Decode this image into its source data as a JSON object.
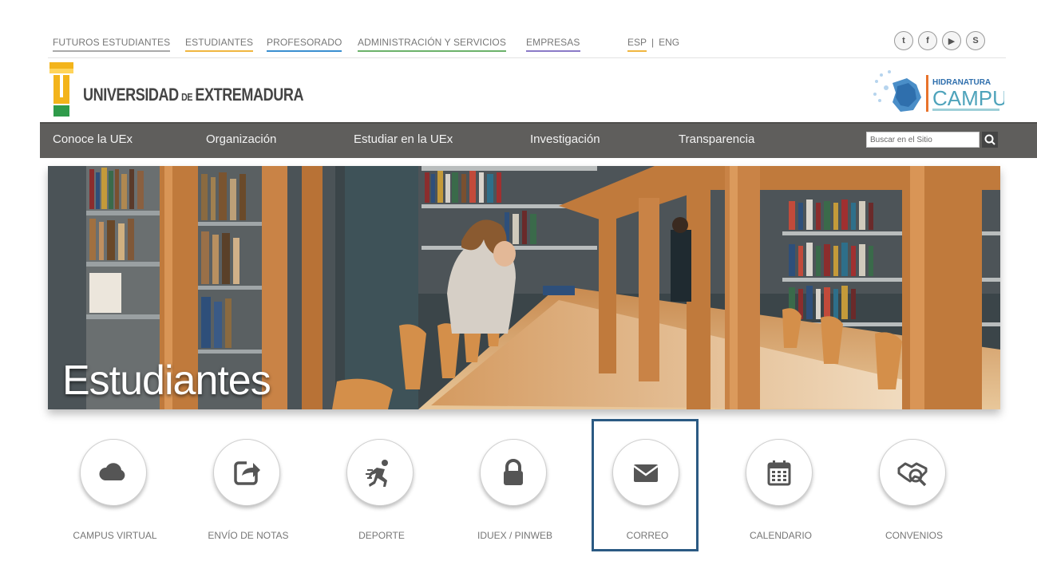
{
  "audience_nav": [
    {
      "label": "FUTUROS ESTUDIANTES",
      "color": "#aaaaaa"
    },
    {
      "label": "ESTUDIANTES",
      "color": "#f0b640"
    },
    {
      "label": "PROFESORADO",
      "color": "#3a8fd0"
    },
    {
      "label": "ADMINISTRACIÓN Y SERVICIOS",
      "color": "#6cb26a"
    },
    {
      "label": "EMPRESAS",
      "color": "#8a7ac7"
    }
  ],
  "language": {
    "esp": "ESP",
    "separator": "|",
    "eng": "ENG"
  },
  "social_icons": [
    "twitter-icon",
    "facebook-icon",
    "youtube-icon",
    "stumbleupon-icon"
  ],
  "brand": {
    "name_part1": "UNIVERSIDAD",
    "name_de": "DE",
    "name_part2": "EXTREMADURA",
    "mark_letters": "U",
    "mark_ex": "EX",
    "campus_top": "HIDRANATURA",
    "campus_bottom": "CAMPUS"
  },
  "main_nav": [
    "Conoce la UEx",
    "Organización",
    "Estudiar en la UEx",
    "Investigación",
    "Transparencia"
  ],
  "search": {
    "placeholder": "Buscar en el Sitio"
  },
  "hero": {
    "title": "Estudiantes"
  },
  "quick_links": [
    {
      "label": "CAMPUS VIRTUAL",
      "icon": "cloud-icon"
    },
    {
      "label": "ENVÍO DE NOTAS",
      "icon": "share-icon"
    },
    {
      "label": "DEPORTE",
      "icon": "runner-icon"
    },
    {
      "label": "IDUEX / PINWEB",
      "icon": "lock-icon"
    },
    {
      "label": "CORREO",
      "icon": "envelope-icon"
    },
    {
      "label": "CALENDARIO",
      "icon": "calendar-icon"
    },
    {
      "label": "CONVENIOS",
      "icon": "handshake-icon"
    }
  ],
  "colors": {
    "nav_bg": "#5f5e5c",
    "highlight": "#2b5a83",
    "accent": "#f0b640"
  }
}
